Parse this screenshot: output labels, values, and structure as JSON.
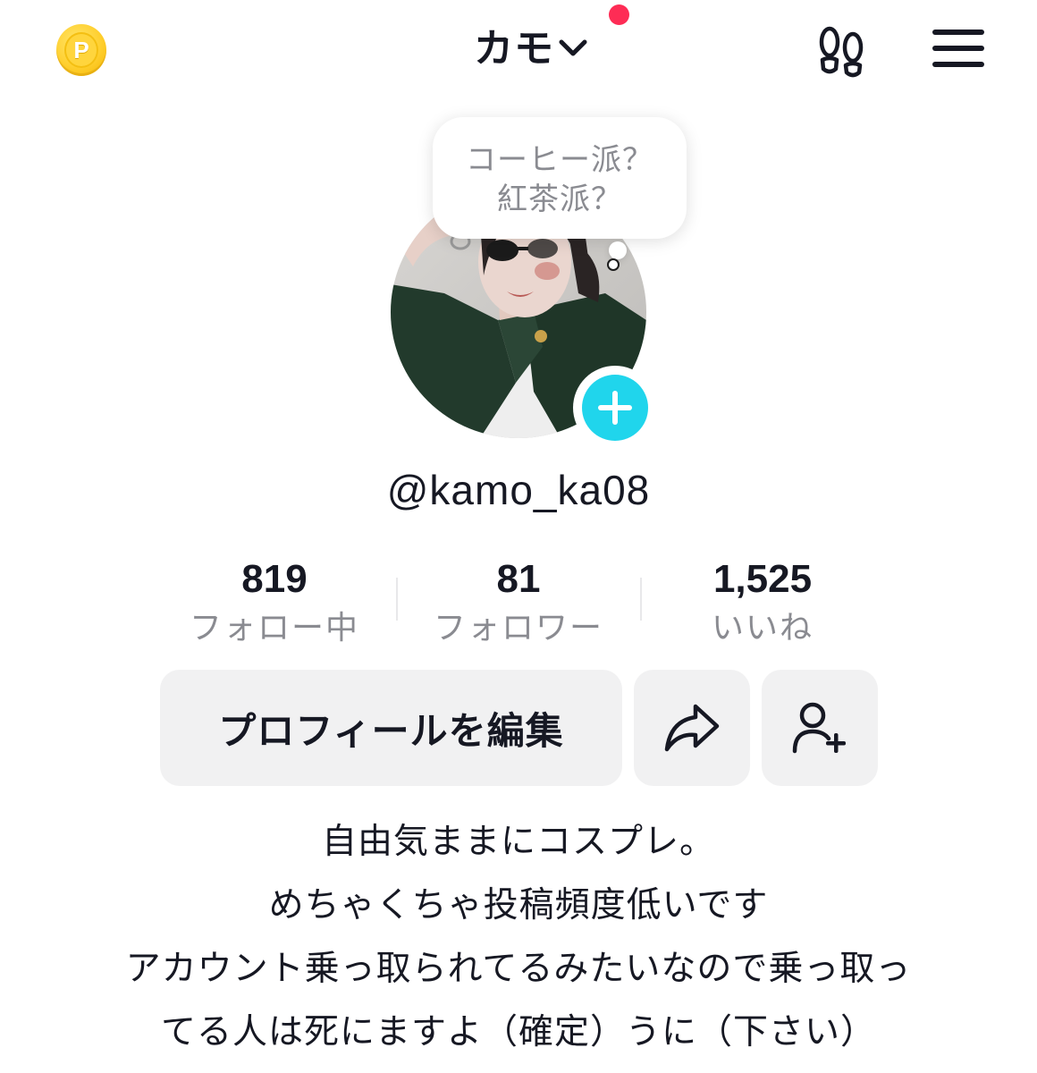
{
  "header": {
    "title": "カモ",
    "coin_label": "P"
  },
  "profile": {
    "status_bubble": [
      "コーヒー派？",
      "紅茶派？"
    ],
    "username": "@kamo_ka08"
  },
  "stats": [
    {
      "value": "819",
      "label": "フォロー中"
    },
    {
      "value": "81",
      "label": "フォロワー"
    },
    {
      "value": "1,525",
      "label": "いいね"
    }
  ],
  "actions": {
    "edit_profile_label": "プロフィールを編集"
  },
  "bio": [
    "自由気ままにコスプレ。",
    "めちゃくちゃ投稿頻度低いです",
    "アカウント乗っ取られてるみたいなので乗っ取っ",
    "てる人は死にますよ（確定）うに（下さい）"
  ],
  "colors": {
    "accent_red": "#fe2c55",
    "accent_cyan": "#20d5ec",
    "button_bg": "#f1f1f2",
    "muted_text": "#8a8b91"
  },
  "icons": {
    "coin": "coin-icon",
    "dropdown": "chevron-down-icon",
    "profile_views": "footprints-icon",
    "menu": "hamburger-menu-icon",
    "add": "plus-icon",
    "share": "share-arrow-icon",
    "add_friend": "add-user-icon"
  }
}
